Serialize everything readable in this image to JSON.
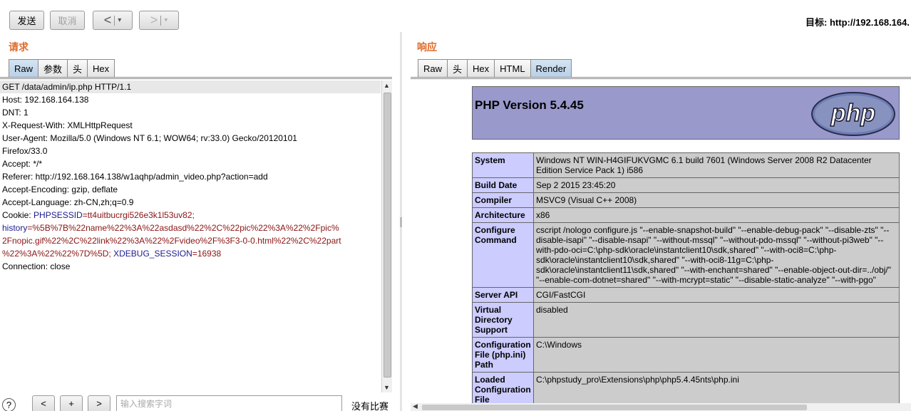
{
  "toolbar": {
    "send_label": "发送",
    "cancel_label": "取消",
    "back_label": "<",
    "forward_label": ">",
    "dropdown_label": "▾",
    "target_label": "目标: http://192.168.164."
  },
  "request": {
    "title": "请求",
    "tabs": [
      "Raw",
      "参数",
      "头",
      "Hex"
    ],
    "active_tab": "Raw",
    "lines": [
      "GET /data/admin/ip.php HTTP/1.1",
      "Host: 192.168.164.138",
      "DNT: 1",
      "X-Request-With: XMLHttpRequest",
      "User-Agent: Mozilla/5.0 (Windows NT 6.1; WOW64; rv:33.0) Gecko/20120101",
      "Firefox/33.0",
      "Accept: */*",
      "Referer: http://192.168.164.138/w1aqhp/admin_video.php?action=add",
      "Accept-Encoding: gzip, deflate",
      "Accept-Language: zh-CN,zh;q=0.9"
    ],
    "cookie": {
      "label": "Cookie: ",
      "phpsessid_name": "PHPSESSID",
      "phpsessid_value": "=tt4uitbucrgi526e3k1l53uv82;",
      "history_name": "history",
      "history_value_1": "=%5B%7B%22name%22%3A%22asdasd%22%2C%22pic%22%3A%22%2Fpic%",
      "history_value_2": "2Fnopic.gif%22%2C%22link%22%3A%22%2Fvideo%2F%3F3-0-0.html%22%2C%22part",
      "history_value_3": "%22%3A%22%22%7D%5D;",
      "xdebug_name": "XDEBUG_SESSION",
      "xdebug_value": "=16938"
    },
    "connection": "Connection: close"
  },
  "bottom": {
    "help": "?",
    "prev": "<",
    "add": "+",
    "next": ">",
    "search_placeholder": "输入搜索字词",
    "match_status": "没有比赛"
  },
  "response": {
    "title": "响应",
    "tabs": [
      "Raw",
      "头",
      "Hex",
      "HTML",
      "Render"
    ],
    "active_tab": "Render",
    "php_title": "PHP Version 5.4.45",
    "php_logo_text": "php",
    "rows": [
      {
        "key": "System",
        "value": "Windows NT WIN-H4GIFUKVGMC 6.1 build 7601 (Windows Server 2008 R2 Datacenter Edition Service Pack 1) i586"
      },
      {
        "key": "Build Date",
        "value": "Sep 2 2015 23:45:20"
      },
      {
        "key": "Compiler",
        "value": "MSVC9 (Visual C++ 2008)"
      },
      {
        "key": "Architecture",
        "value": "x86"
      },
      {
        "key": "Configure Command",
        "value": "cscript /nologo configure.js \"--enable-snapshot-build\" \"--enable-debug-pack\" \"--disable-zts\" \"--disable-isapi\" \"--disable-nsapi\" \"--without-mssql\" \"--without-pdo-mssql\" \"--without-pi3web\" \"--with-pdo-oci=C:\\php-sdk\\oracle\\instantclient10\\sdk,shared\" \"--with-oci8=C:\\php-sdk\\oracle\\instantclient10\\sdk,shared\" \"--with-oci8-11g=C:\\php-sdk\\oracle\\instantclient11\\sdk,shared\" \"--with-enchant=shared\" \"--enable-object-out-dir=../obj/\" \"--enable-com-dotnet=shared\" \"--with-mcrypt=static\" \"--disable-static-analyze\" \"--with-pgo\""
      },
      {
        "key": "Server API",
        "value": "CGI/FastCGI"
      },
      {
        "key": "Virtual Directory Support",
        "value": "disabled"
      },
      {
        "key": "Configuration File (php.ini) Path",
        "value": "C:\\Windows"
      },
      {
        "key": "Loaded Configuration File",
        "value": "C:\\phpstudy_pro\\Extensions\\php\\php5.4.45nts\\php.ini"
      }
    ]
  },
  "colors": {
    "section_title": "#e06a28",
    "php_header": "#9999cc",
    "php_key_cell": "#ccccff",
    "php_value_cell": "#cccccc",
    "cookie_name": "#1b1b8f",
    "cookie_value": "#8a1313"
  }
}
